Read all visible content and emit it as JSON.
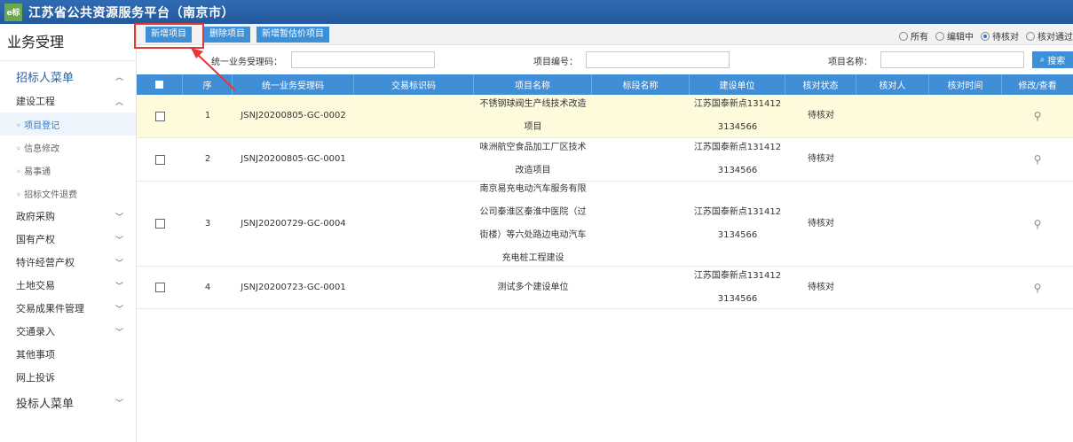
{
  "header": {
    "logo_text": "e标",
    "title": "江苏省公共资源服务平台（南京市）"
  },
  "sidebar": {
    "title": "业务受理",
    "groups": [
      {
        "label": "招标人菜单"
      },
      {
        "label": "投标人菜单"
      }
    ],
    "items": [
      {
        "label": "建设工程"
      },
      {
        "label": "政府采购"
      },
      {
        "label": "国有产权"
      },
      {
        "label": "特许经营产权"
      },
      {
        "label": "土地交易"
      },
      {
        "label": "交易成果件管理"
      },
      {
        "label": "交通录入"
      },
      {
        "label": "其他事项"
      },
      {
        "label": "网上投诉"
      }
    ],
    "sub_items": [
      {
        "label": "◦ 项目登记"
      },
      {
        "label": "◦ 信息修改"
      },
      {
        "label": "◦ 易事通"
      },
      {
        "label": "◦ 招标文件退费"
      }
    ]
  },
  "toolbar": {
    "buttons": [
      "新增项目",
      "删除项目",
      "新增暂估价项目"
    ],
    "radios": [
      {
        "label": "所有"
      },
      {
        "label": "编辑中"
      },
      {
        "label": "待核对",
        "checked": true
      },
      {
        "label": "核对通过"
      }
    ]
  },
  "search": {
    "label1": "统一业务受理码：",
    "label2": "项目编号：",
    "label3": "项目名称：",
    "button": "搜索"
  },
  "table": {
    "headers": [
      "序",
      "统一业务受理码",
      "交易标识码",
      "项目名称",
      "标段名称",
      "建设单位",
      "核对状态",
      "核对人",
      "核对时间",
      "修改/查看"
    ],
    "rows": [
      {
        "no": "1",
        "code": "JSNJ20200805-GC-0002",
        "name": [
          "不锈钢球阀生产线技术改造",
          "项目"
        ],
        "unit": [
          "江苏国泰新点131412",
          "3134566"
        ],
        "status": "待核对"
      },
      {
        "no": "2",
        "code": "JSNJ20200805-GC-0001",
        "name": [
          "味洲航空食品加工厂区技术",
          "改造项目"
        ],
        "unit": [
          "江苏国泰新点131412",
          "3134566"
        ],
        "status": "待核对"
      },
      {
        "no": "3",
        "code": "JSNJ20200729-GC-0004",
        "name": [
          "南京易充电动汽车服务有限",
          "公司秦淮区秦淮中医院（过",
          "街楼）等六处路边电动汽车",
          "充电桩工程建设"
        ],
        "unit": [
          "江苏国泰新点131412",
          "3134566"
        ],
        "status": "待核对"
      },
      {
        "no": "4",
        "code": "JSNJ20200723-GC-0001",
        "name": [
          "测试多个建设单位"
        ],
        "unit": [
          "江苏国泰新点131412",
          "3134566"
        ],
        "status": "待核对"
      }
    ]
  },
  "colors": {
    "header_bg": "#2f6bb3",
    "accent": "#3d8fd6",
    "highlight": "#e63737",
    "row_highlight": "#fdfbdc"
  }
}
